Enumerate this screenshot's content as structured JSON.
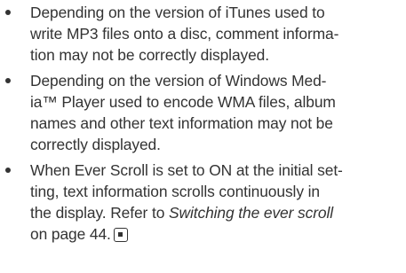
{
  "bullets": [
    {
      "lines": [
        "Depending on the version of iTunes used to",
        "write MP3 files onto a disc, comment informa-",
        "tion may not be correctly displayed."
      ]
    },
    {
      "lines": [
        "Depending on the version of Windows Med-",
        "ia™ Player used to encode WMA files, album",
        "names and other text information may not be",
        "correctly displayed."
      ]
    },
    {
      "lines": [
        "When Ever Scroll is set to ON at the initial set-",
        "ting, text information scrolls continuously in"
      ],
      "line3_before": "the display. Refer to ",
      "line3_italic": "Switching the ever scroll",
      "line4": "on page 44."
    }
  ]
}
